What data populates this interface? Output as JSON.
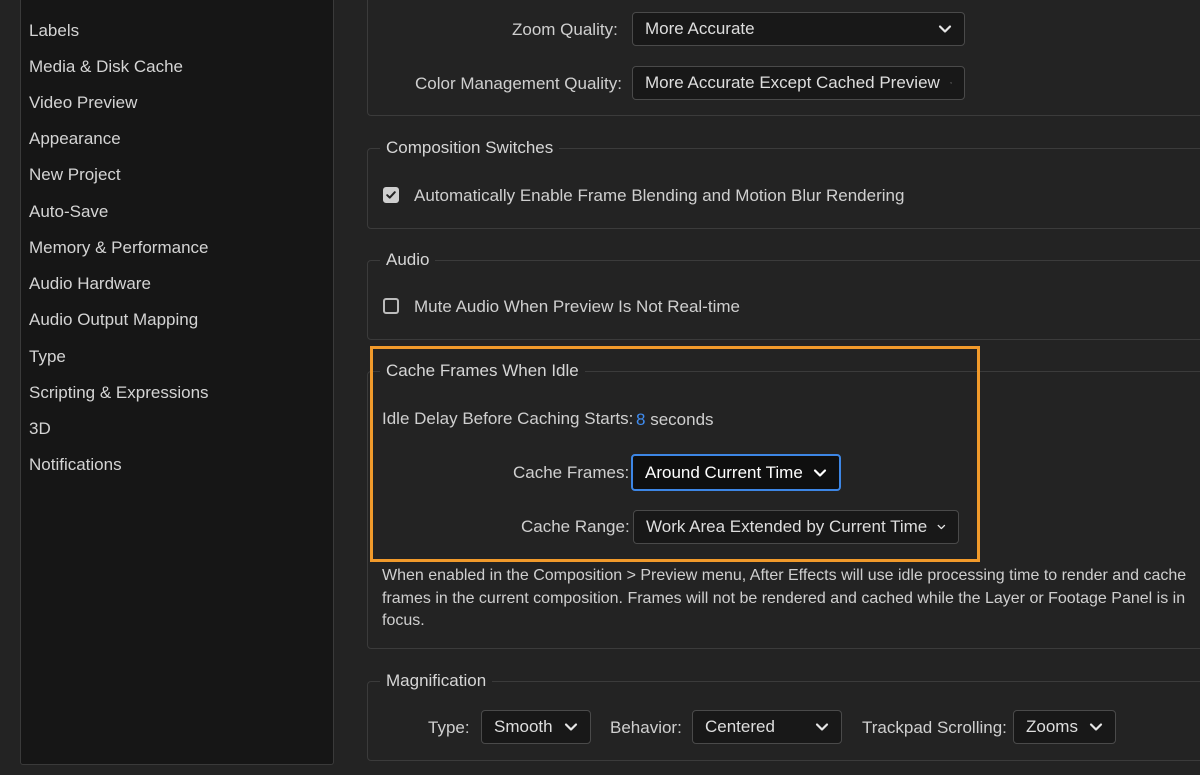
{
  "sidebar": {
    "items": [
      {
        "label": "Labels"
      },
      {
        "label": "Media & Disk Cache"
      },
      {
        "label": "Video Preview"
      },
      {
        "label": "Appearance"
      },
      {
        "label": "New Project"
      },
      {
        "label": "Auto-Save"
      },
      {
        "label": "Memory & Performance"
      },
      {
        "label": "Audio Hardware"
      },
      {
        "label": "Audio Output Mapping"
      },
      {
        "label": "Type"
      },
      {
        "label": "Scripting & Expressions"
      },
      {
        "label": "3D"
      },
      {
        "label": "Notifications"
      }
    ]
  },
  "quality": {
    "zoom_label": "Zoom Quality:",
    "zoom_value": "More Accurate",
    "color_label": "Color Management Quality:",
    "color_value": "More Accurate Except Cached Preview"
  },
  "composition_switches": {
    "title": "Composition Switches",
    "frame_blending_label": "Automatically Enable Frame Blending and Motion Blur Rendering",
    "frame_blending_checked": true
  },
  "audio": {
    "title": "Audio",
    "mute_label": "Mute Audio When Preview Is Not Real-time",
    "mute_checked": false
  },
  "cache_idle": {
    "title": "Cache Frames When Idle",
    "idle_delay_label": "Idle Delay Before Caching Starts:",
    "idle_delay_value": "8",
    "idle_delay_unit": "seconds",
    "cache_frames_label": "Cache Frames:",
    "cache_frames_value": "Around Current Time",
    "cache_range_label": "Cache Range:",
    "cache_range_value": "Work Area Extended by Current Time",
    "description": "When enabled in the Composition > Preview menu, After Effects will use idle processing time to render and cache frames in the current composition. Frames will not be rendered and cached while the Layer or Footage Panel is in focus."
  },
  "magnification": {
    "title": "Magnification",
    "type_label": "Type:",
    "type_value": "Smooth",
    "behavior_label": "Behavior:",
    "behavior_value": "Centered",
    "trackpad_label": "Trackpad Scrolling:",
    "trackpad_value": "Zooms"
  },
  "colors": {
    "accent": "#3d86e5",
    "highlight": "#f19a2b",
    "link_value": "#3f8cf0"
  }
}
